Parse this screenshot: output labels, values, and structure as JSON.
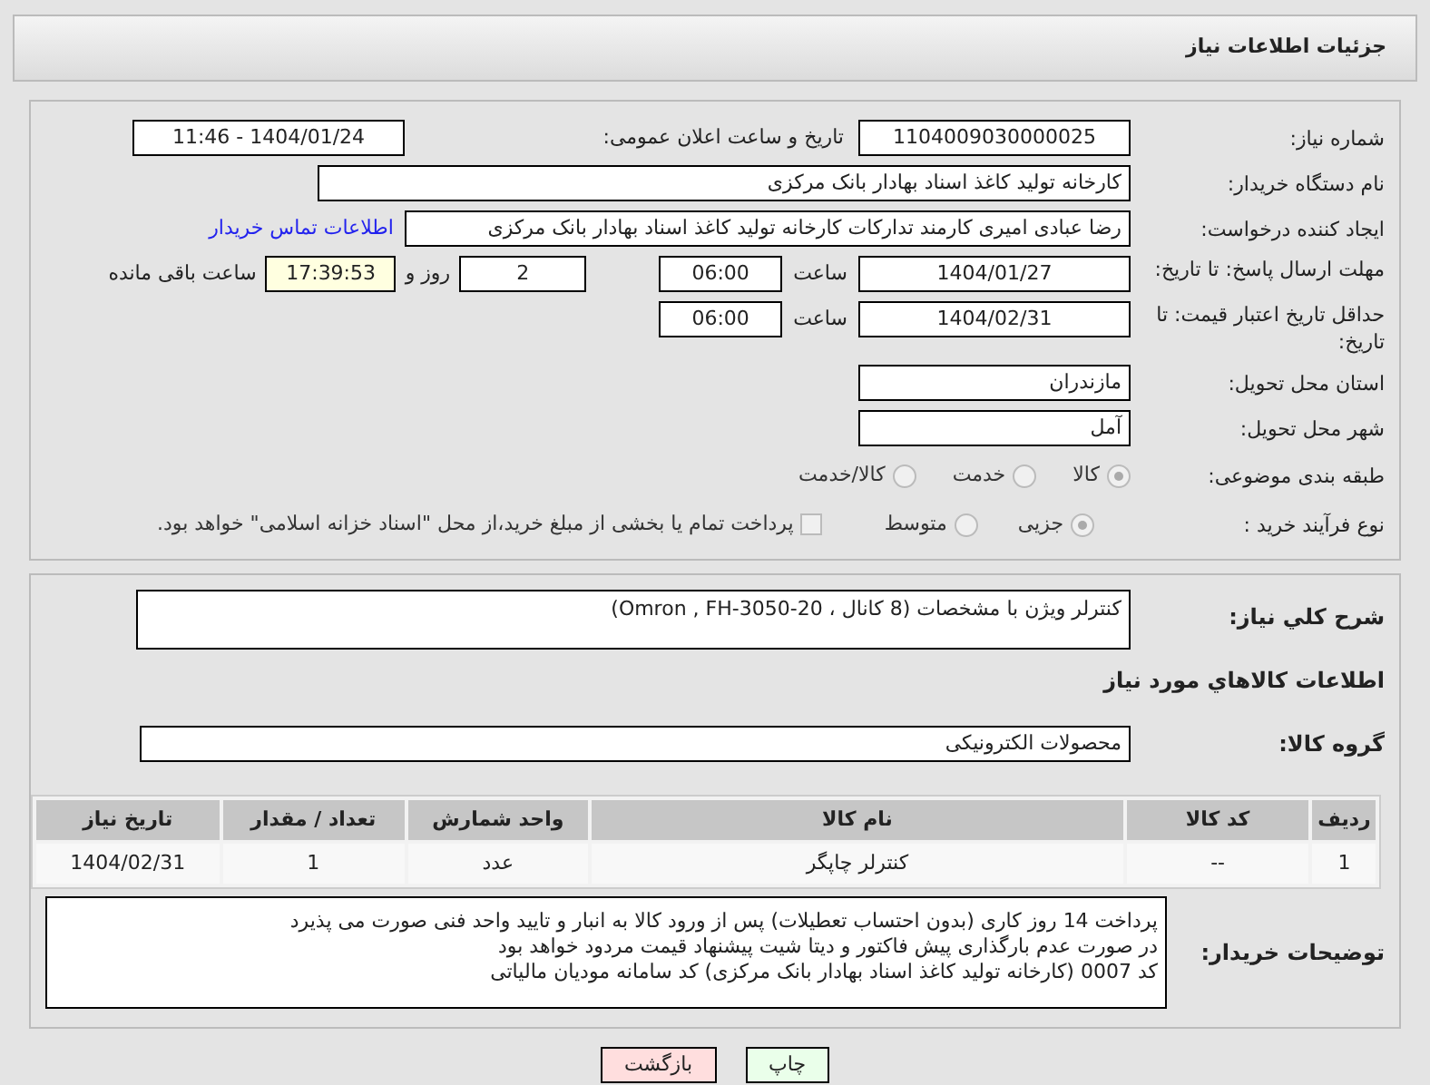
{
  "header": {
    "title": "جزئیات اطلاعات نیاز"
  },
  "need_number": {
    "label": "شماره نیاز:",
    "value": "1104009030000025"
  },
  "announce": {
    "label": "تاریخ و ساعت اعلان عمومی:",
    "value": "1404/01/24 - 11:46"
  },
  "buyer_org": {
    "label": "نام دستگاه خریدار:",
    "value": "کارخانه تولید کاغذ اسناد بهادار بانک مرکزی"
  },
  "creator": {
    "label": "ایجاد کننده درخواست:",
    "value": "رضا عبادی امیری کارمند تدارکات کارخانه تولید کاغذ اسناد بهادار بانک مرکزی",
    "link": "اطلاعات تماس خریدار"
  },
  "deadline": {
    "label": "مهلت ارسال پاسخ: تا تاریخ:",
    "date": "1404/01/27",
    "time_label": "ساعت",
    "time": "06:00",
    "days": "2",
    "days_label": "روز و",
    "remaining": "17:39:53",
    "remaining_label": "ساعت باقی مانده"
  },
  "validity": {
    "label": "حداقل تاریخ اعتبار قیمت: تا تاریخ:",
    "date": "1404/02/31",
    "time_label": "ساعت",
    "time": "06:00"
  },
  "province": {
    "label": "استان محل تحویل:",
    "value": "مازندران"
  },
  "city": {
    "label": "شهر محل تحویل:",
    "value": "آمل"
  },
  "category": {
    "label": "طبقه بندی موضوعی:",
    "options": [
      {
        "label": "کالا",
        "selected": true
      },
      {
        "label": "خدمت",
        "selected": false
      },
      {
        "label": "کالا/خدمت",
        "selected": false
      }
    ]
  },
  "process": {
    "label": "نوع فرآیند خرید :",
    "options": [
      {
        "label": "جزیی",
        "selected": true
      },
      {
        "label": "متوسط",
        "selected": false
      }
    ],
    "treasury": {
      "label": "پرداخت تمام یا بخشی از مبلغ خرید،از محل \"اسناد خزانه اسلامی\" خواهد بود.",
      "checked": false
    }
  },
  "description": {
    "label": "شرح کلي نياز:",
    "value": "کنترلر ویژن با مشخصات (8 کانال ، Omron , FH-3050-20)"
  },
  "goods_heading": "اطلاعات کالاهاي مورد نياز",
  "goods_group": {
    "label": "گروه کالا:",
    "value": "محصولات الکترونیکی"
  },
  "table": {
    "columns": [
      "ردیف",
      "کد کالا",
      "نام کالا",
      "واحد شمارش",
      "تعداد / مقدار",
      "تاریخ نیاز"
    ],
    "rows": [
      [
        "1",
        "--",
        "کنترلر چاپگر",
        "عدد",
        "1",
        "1404/02/31"
      ]
    ]
  },
  "buyer_notes": {
    "label": "توضیحات خریدار:",
    "lines": [
      "پرداخت 14 روز کاری (بدون احتساب تعطیلات) پس از ورود کالا به انبار و تایید واحد فنی صورت می پذیرد",
      "در صورت عدم بارگذاری پیش فاکتور و دیتا شیت پیشنهاد قیمت مردود خواهد بود",
      "کد 0007 (کارخانه تولید کاغذ اسناد بهادار بانک مرکزی) کد سامانه مودیان مالیاتی"
    ]
  },
  "buttons": [
    {
      "label": "چاپ",
      "kind": "print"
    },
    {
      "label": "بازگشت",
      "kind": "back"
    }
  ]
}
